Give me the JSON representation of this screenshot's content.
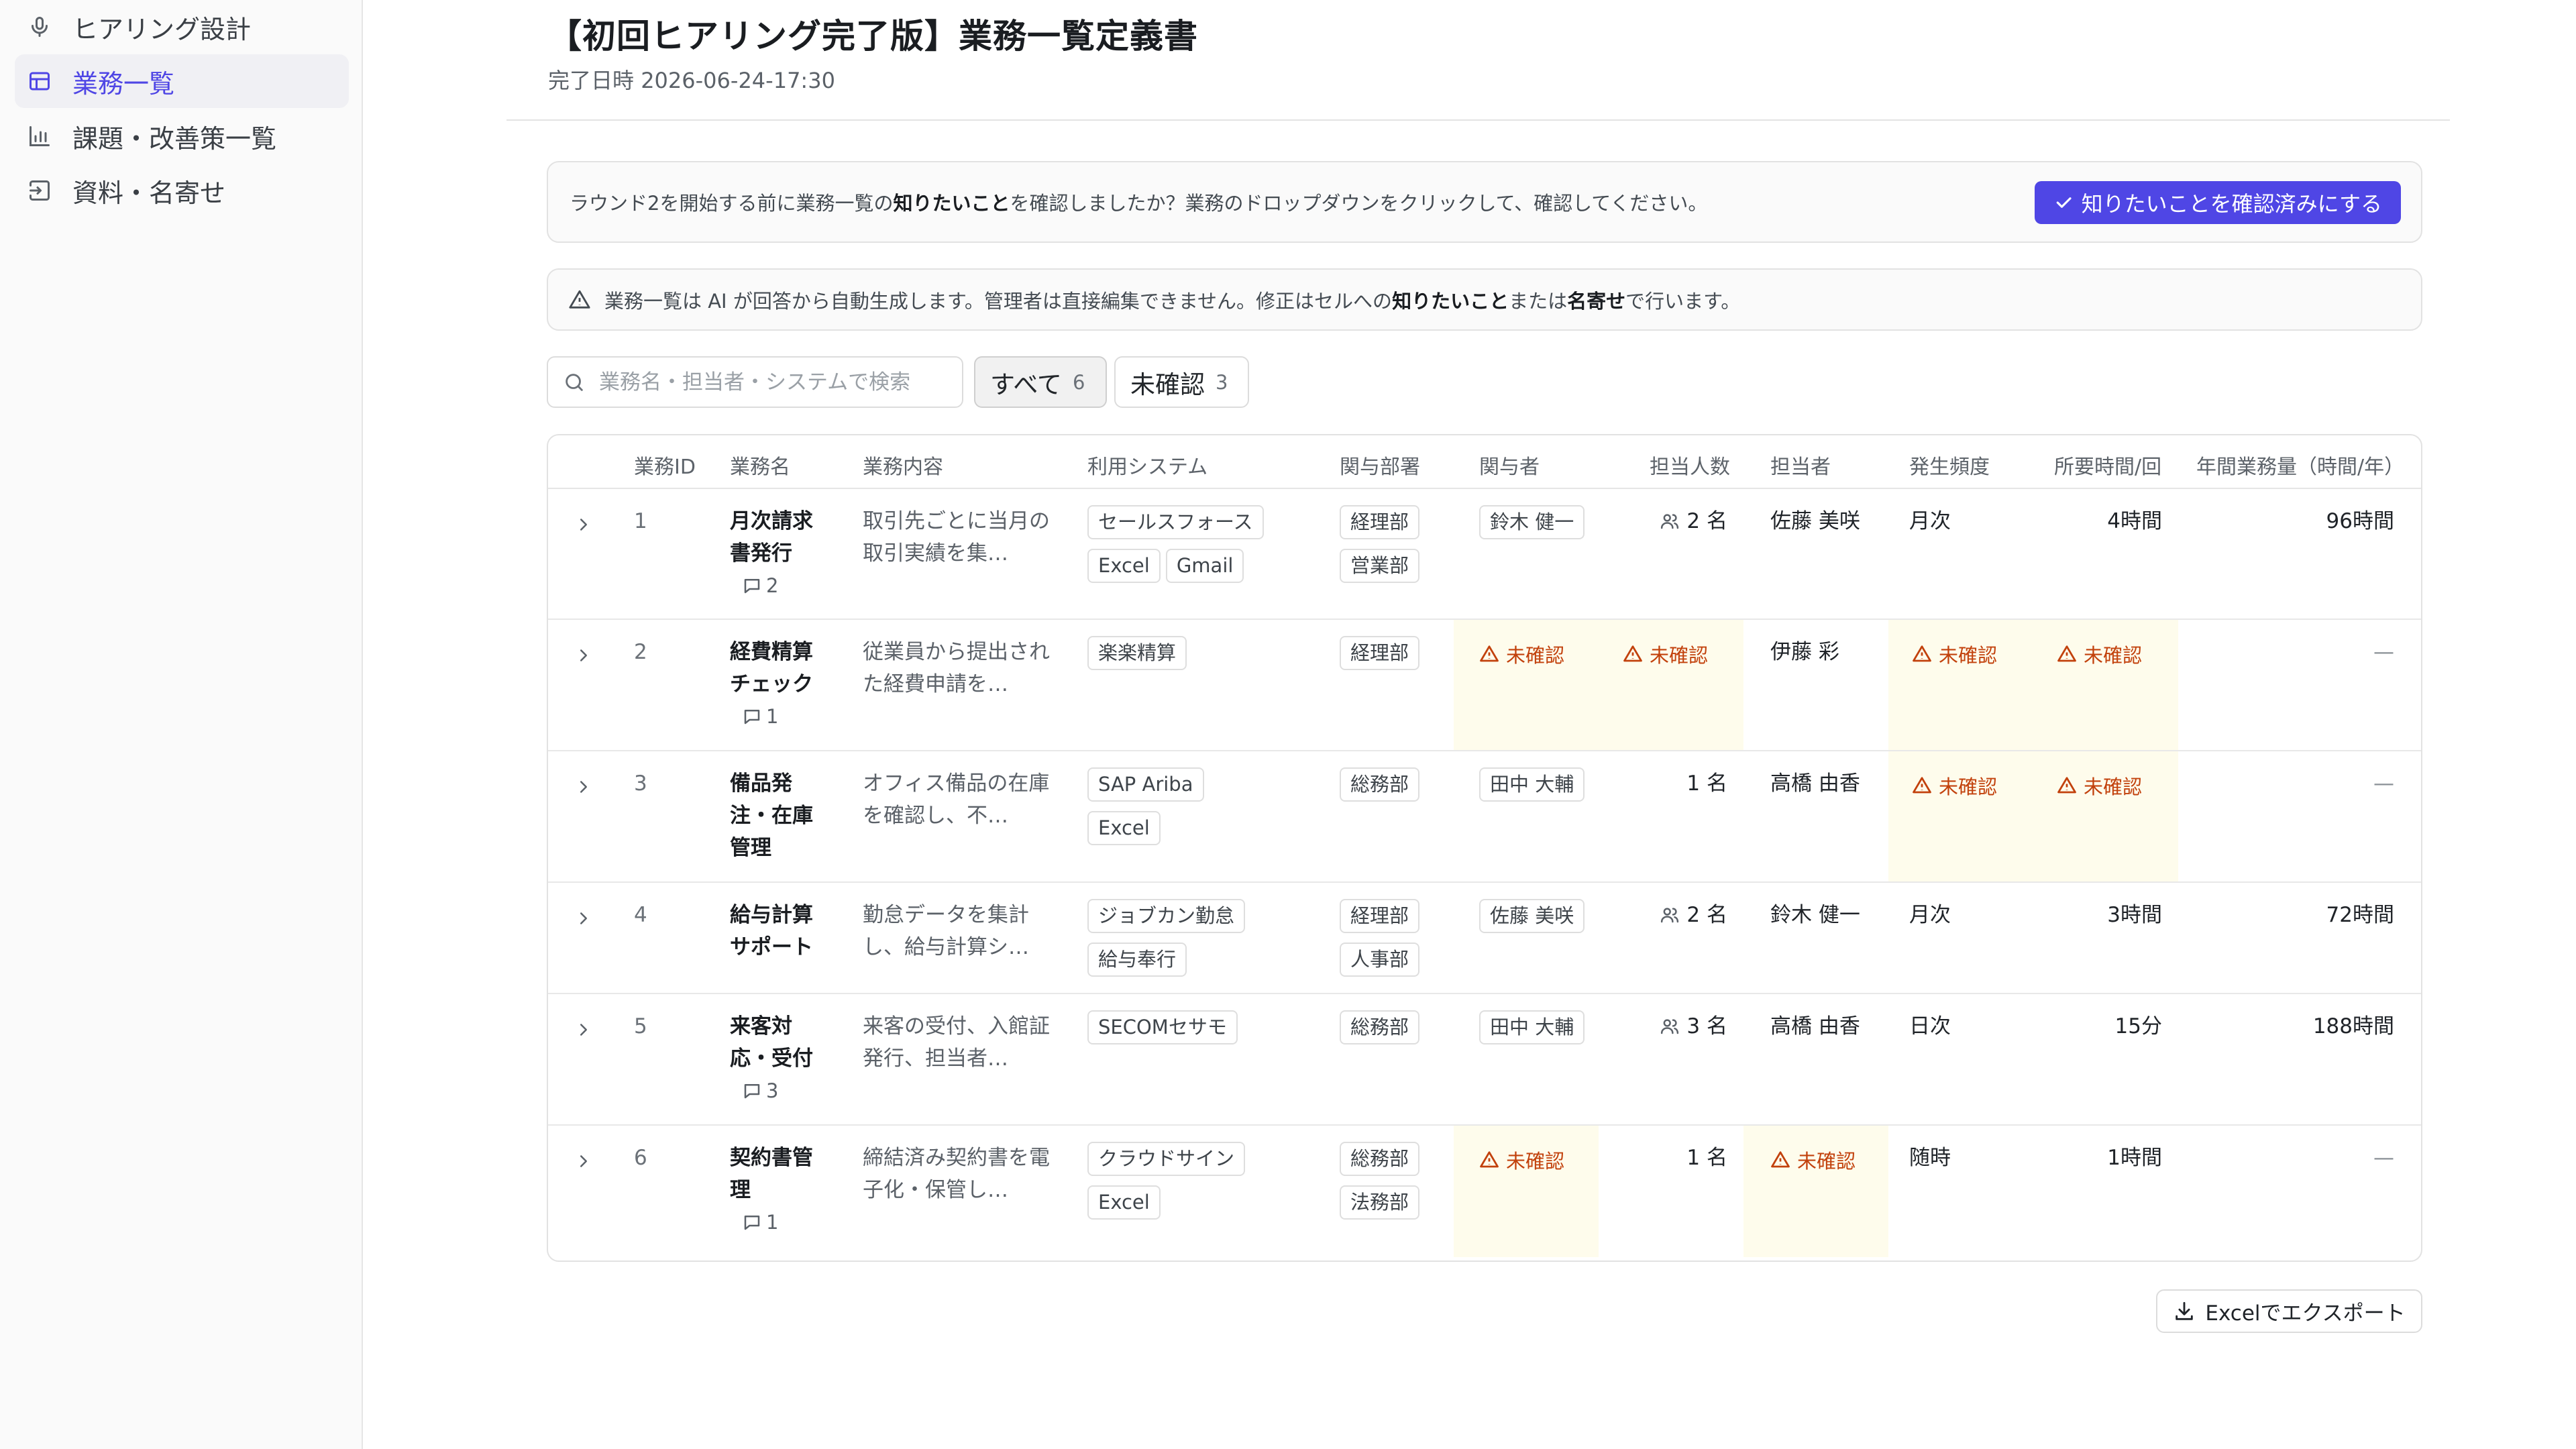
{
  "sidebar": {
    "items": [
      {
        "label": "ヒアリング設計",
        "icon": "microphone-icon",
        "active": false
      },
      {
        "label": "業務一覧",
        "icon": "table-icon",
        "active": true
      },
      {
        "label": "課題・改善策一覧",
        "icon": "bar-chart-icon",
        "active": false
      },
      {
        "label": "資料・名寄せ",
        "icon": "import-icon",
        "active": false
      }
    ]
  },
  "header": {
    "title": "【初回ヒアリング完了版】業務一覧定義書",
    "completed_label": "完了日時",
    "completed_at": "2026-06-24-17:30"
  },
  "confirm_banner": {
    "text_before": "ラウンド2を開始する前に業務一覧の",
    "text_bold": "知りたいこと",
    "text_after": "を確認しましたか？業務のドロップダウンをクリックして、確認してください。",
    "button_label": "知りたいことを確認済みにする"
  },
  "info_banner": {
    "text_before": "業務一覧は AI が回答から自動生成します。管理者は直接編集できません。修正はセルへの",
    "bold1": "知りたいこと",
    "mid": "または",
    "bold2": "名寄せ",
    "text_after": "で行います。"
  },
  "search": {
    "placeholder": "業務名・担当者・システムで検索"
  },
  "filters": [
    {
      "label": "すべて",
      "count": "6",
      "active": true
    },
    {
      "label": "未確認",
      "count": "3",
      "active": false
    }
  ],
  "table": {
    "columns": [
      "業務ID",
      "業務名",
      "業務内容",
      "利用システム",
      "関与部署",
      "関与者",
      "担当人数",
      "担当者",
      "発生頻度",
      "所要時間/回",
      "年間業務量（時間/年）"
    ],
    "unconfirmed_label": "未確認",
    "rows": [
      {
        "id": "1",
        "name": "月次請求書発行",
        "comments": "2",
        "desc": "取引先ごとに当月の取引実績を集…",
        "systems": [
          "セールスフォース",
          "Excel",
          "Gmail"
        ],
        "depts": [
          "経理部",
          "営業部"
        ],
        "involved": "鈴木 健一",
        "headcount": "2 名",
        "headcount_multi": true,
        "owner": "佐藤 美咲",
        "frequency": "月次",
        "time_per": "4時間",
        "annual": "96時間"
      },
      {
        "id": "2",
        "name": "経費精算チェック",
        "comments": "1",
        "desc": "従業員から提出された経費申請を…",
        "systems": [
          "楽楽精算"
        ],
        "depts": [
          "経理部"
        ],
        "involved": "未確認",
        "headcount": "未確認",
        "headcount_multi": false,
        "owner": "伊藤 彩",
        "frequency": "未確認",
        "time_per": "未確認",
        "annual": "—"
      },
      {
        "id": "3",
        "name": "備品発注・在庫管理",
        "comments": "",
        "desc": "オフィス備品の在庫を確認し、不…",
        "systems": [
          "SAP Ariba",
          "Excel"
        ],
        "depts": [
          "総務部"
        ],
        "involved": "田中 大輔",
        "headcount": "1 名",
        "headcount_multi": false,
        "owner": "高橋 由香",
        "frequency": "未確認",
        "time_per": "未確認",
        "annual": "—"
      },
      {
        "id": "4",
        "name": "給与計算サポート",
        "comments": "",
        "desc": "勤怠データを集計し、給与計算シ…",
        "systems": [
          "ジョブカン勤怠",
          "給与奉行"
        ],
        "depts": [
          "経理部",
          "人事部"
        ],
        "involved": "佐藤 美咲",
        "headcount": "2 名",
        "headcount_multi": true,
        "owner": "鈴木 健一",
        "frequency": "月次",
        "time_per": "3時間",
        "annual": "72時間"
      },
      {
        "id": "5",
        "name": "来客対応・受付",
        "comments": "3",
        "desc": "来客の受付、入館証発行、担当者…",
        "systems": [
          "SECOMセサモ"
        ],
        "depts": [
          "総務部"
        ],
        "involved": "田中 大輔",
        "headcount": "3 名",
        "headcount_multi": true,
        "owner": "高橋 由香",
        "frequency": "日次",
        "time_per": "15分",
        "annual": "188時間"
      },
      {
        "id": "6",
        "name": "契約書管理",
        "comments": "1",
        "desc": "締結済み契約書を電子化・保管し…",
        "systems": [
          "クラウドサイン",
          "Excel"
        ],
        "depts": [
          "総務部",
          "法務部"
        ],
        "involved": "未確認",
        "headcount": "1 名",
        "headcount_multi": false,
        "owner": "未確認",
        "frequency": "随時",
        "time_per": "1時間",
        "annual": "—"
      }
    ]
  },
  "export": {
    "label": "Excelでエクスポート"
  }
}
